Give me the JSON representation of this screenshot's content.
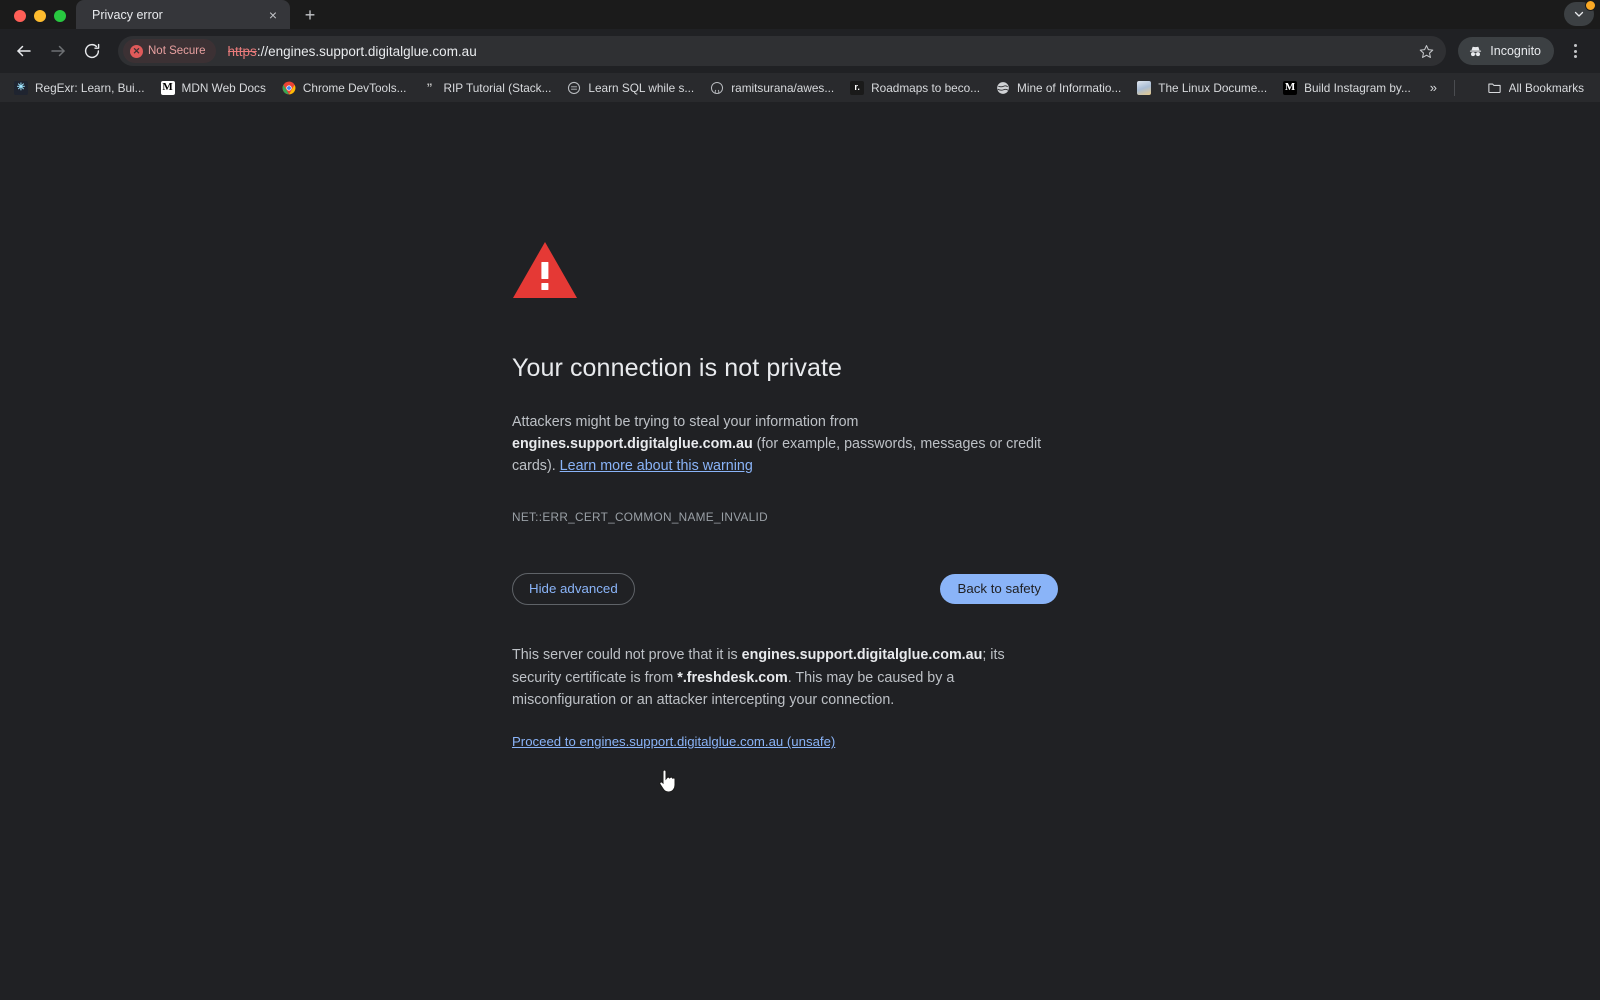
{
  "window": {
    "traffic_lights": [
      "close",
      "minimize",
      "zoom"
    ]
  },
  "tabstrip": {
    "tabs": [
      {
        "title": "Privacy error",
        "close_label": "×",
        "active": true
      }
    ],
    "new_tab_label": "+",
    "update_chevron_name": "chevron-down-icon",
    "update_dot_color": "#f9a825"
  },
  "toolbar": {
    "back_label": "←",
    "forward_label": "→",
    "reload_label": "⟳",
    "security": {
      "badge_label": "Not Secure",
      "badge_icon_glyph": "✕",
      "badge_bg": "#3c3134",
      "badge_text_color": "#e8a0a0"
    },
    "url": {
      "scheme": "https",
      "rest": "://engines.support.digitalglue.com.au",
      "full": "https://engines.support.digitalglue.com.au"
    },
    "star_title": "Bookmark this tab",
    "incognito_label": "Incognito",
    "menu_title": "Customize and control Google Chrome"
  },
  "bookmarks": {
    "items": [
      {
        "label": "RegExr: Learn, Bui...",
        "icon": "regexr-favicon",
        "glyph": "✳"
      },
      {
        "label": "MDN Web Docs",
        "icon": "mdn-favicon",
        "glyph": "M"
      },
      {
        "label": "Chrome DevTools...",
        "icon": "chrome-devtools-favicon",
        "glyph": ""
      },
      {
        "label": "RIP Tutorial (Stack...",
        "icon": "rip-tutorial-favicon",
        "glyph": "”"
      },
      {
        "label": "Learn SQL while s...",
        "icon": "learn-sql-favicon",
        "glyph": ""
      },
      {
        "label": "ramitsurana/awes...",
        "icon": "github-favicon",
        "glyph": ""
      },
      {
        "label": "Roadmaps to beco...",
        "icon": "roadmap-favicon",
        "glyph": "r."
      },
      {
        "label": "Mine of Informatio...",
        "icon": "globe-favicon",
        "glyph": ""
      },
      {
        "label": "The Linux Docume...",
        "icon": "linux-doc-favicon",
        "glyph": ""
      },
      {
        "label": "Build Instagram by...",
        "icon": "medium-favicon",
        "glyph": "M"
      }
    ],
    "overflow_label": "»",
    "all_bookmarks_label": "All Bookmarks",
    "all_bookmarks_icon": "folder-icon"
  },
  "page": {
    "icon_name": "warning-triangle-icon",
    "icon_color": "#e53935",
    "heading": "Your connection is not private",
    "body": {
      "lead": "Attackers might be trying to steal your information from ",
      "domain": "engines.support.digitalglue.com.au",
      "tail": " (for example, passwords, messages or credit cards). ",
      "learn_more": "Learn more about this warning"
    },
    "error_code": "NET::ERR_CERT_COMMON_NAME_INVALID",
    "buttons": {
      "advanced_label": "Hide advanced",
      "safety_label": "Back to safety",
      "advanced_text_color": "#8ab4f8",
      "safety_bg": "#8ab4f8"
    },
    "advanced": {
      "part1": "This server could not prove that it is ",
      "server": "engines.support.digitalglue.com.au",
      "part2": "; its security certificate is from ",
      "cert": "*.freshdesk.com",
      "part3": ". This may be caused by a misconfiguration or an attacker intercepting your connection.",
      "proceed_label": "Proceed to engines.support.digitalglue.com.au (unsafe)"
    }
  }
}
